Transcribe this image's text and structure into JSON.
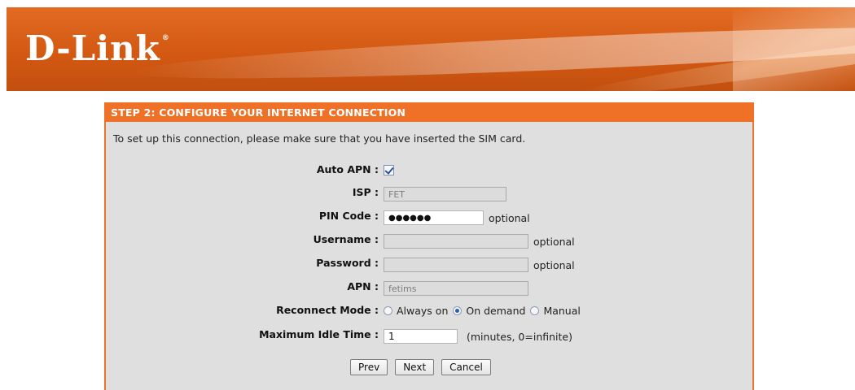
{
  "brand": {
    "logo_text": "D-Link",
    "reg_mark": "®"
  },
  "panel": {
    "title": "STEP 2: CONFIGURE YOUR INTERNET CONNECTION",
    "intro": "To set up this connection, please make sure that you have inserted the SIM card."
  },
  "form": {
    "auto_apn": {
      "label": "Auto APN :",
      "checked": true
    },
    "isp": {
      "label": "ISP :",
      "value": "FET"
    },
    "pin_code": {
      "label": "PIN Code :",
      "value": "●●●●●●",
      "note": "optional"
    },
    "username": {
      "label": "Username :",
      "value": "",
      "note": "optional"
    },
    "password": {
      "label": "Password :",
      "value": "",
      "note": "optional"
    },
    "apn": {
      "label": "APN :",
      "value": "fetims"
    },
    "reconnect_mode": {
      "label": "Reconnect Mode :",
      "options": [
        "Always on",
        "On demand",
        "Manual"
      ],
      "selected": "On demand"
    },
    "max_idle": {
      "label": "Maximum Idle Time :",
      "value": "1",
      "note": "(minutes, 0=infinite)"
    }
  },
  "buttons": {
    "prev": "Prev",
    "next": "Next",
    "cancel": "Cancel"
  },
  "colors": {
    "accent": "#ef7127",
    "panel_bg": "#dfdfdf",
    "banner": "#d25812"
  }
}
